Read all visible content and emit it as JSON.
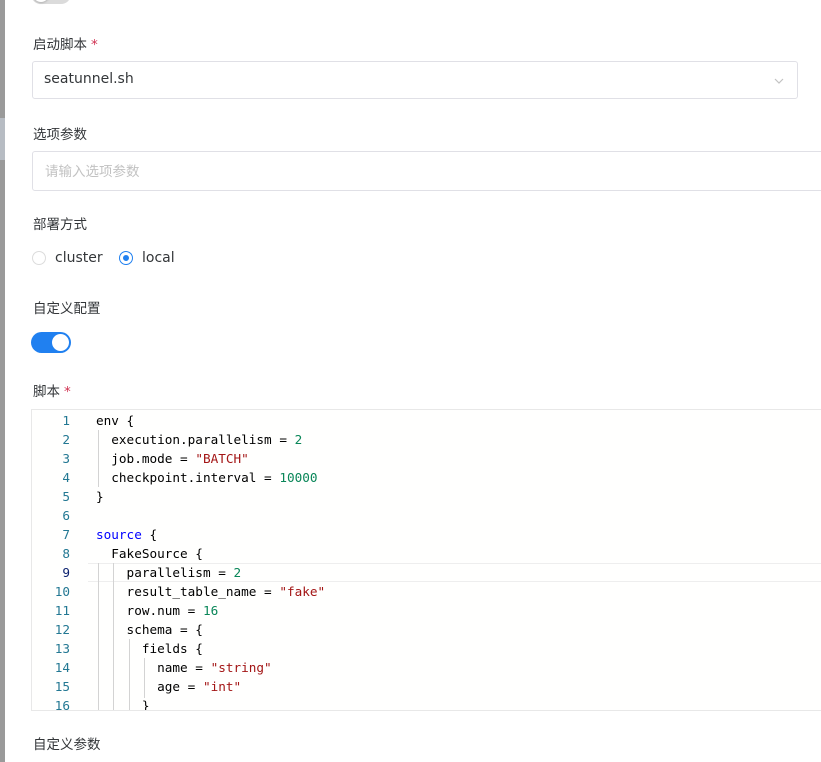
{
  "form": {
    "launch_script": {
      "label": "启动脚本",
      "required_mark": "*",
      "value": "seatunnel.sh"
    },
    "options": {
      "label": "选项参数",
      "placeholder": "请输入选项参数",
      "value": ""
    },
    "deploy_mode": {
      "label": "部署方式",
      "options": [
        {
          "label": "cluster",
          "selected": false
        },
        {
          "label": "local",
          "selected": true
        }
      ]
    },
    "custom_config": {
      "label": "自定义配置",
      "enabled": true
    },
    "script": {
      "label": "脚本",
      "required_mark": "*"
    },
    "custom_params": {
      "label": "自定义参数"
    }
  },
  "editor": {
    "active_line": "9",
    "lines": [
      {
        "n": "1",
        "code": "env {"
      },
      {
        "n": "2",
        "code": "  execution.parallelism = 2"
      },
      {
        "n": "3",
        "code": "  job.mode = \"BATCH\""
      },
      {
        "n": "4",
        "code": "  checkpoint.interval = 10000"
      },
      {
        "n": "5",
        "code": "}"
      },
      {
        "n": "6",
        "code": ""
      },
      {
        "n": "7",
        "code": "source {"
      },
      {
        "n": "8",
        "code": "  FakeSource {"
      },
      {
        "n": "9",
        "code": "    parallelism = 2"
      },
      {
        "n": "10",
        "code": "    result_table_name = \"fake\""
      },
      {
        "n": "11",
        "code": "    row.num = 16"
      },
      {
        "n": "12",
        "code": "    schema = {"
      },
      {
        "n": "13",
        "code": "      fields {"
      },
      {
        "n": "14",
        "code": "        name = \"string\""
      },
      {
        "n": "15",
        "code": "        age = \"int\""
      },
      {
        "n": "16",
        "code": "      }"
      }
    ]
  },
  "colors": {
    "accent": "#2080f0",
    "required": "#d03050",
    "border": "#e0e0e6"
  }
}
